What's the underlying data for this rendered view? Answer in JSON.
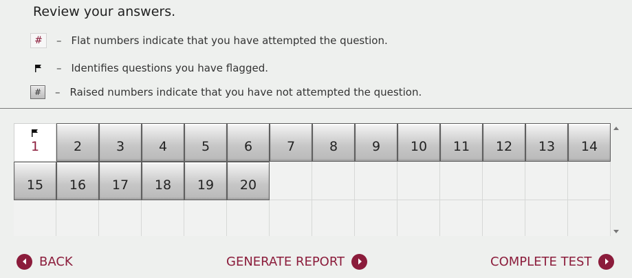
{
  "header": {
    "title": "Review your answers."
  },
  "legend": [
    {
      "symbol": "#",
      "dash": "–",
      "text": "Flat numbers indicate that you have attempted the question."
    },
    {
      "symbol": "",
      "dash": "–",
      "text": "Identifies questions you have flagged."
    },
    {
      "symbol": "#",
      "dash": "–",
      "text": "Raised numbers indicate that you have not attempted the question."
    }
  ],
  "questions": [
    {
      "label": "1",
      "attempted": true,
      "flagged": true
    },
    {
      "label": "2",
      "attempted": false,
      "flagged": false
    },
    {
      "label": "3",
      "attempted": false,
      "flagged": false
    },
    {
      "label": "4",
      "attempted": false,
      "flagged": false
    },
    {
      "label": "5",
      "attempted": false,
      "flagged": false
    },
    {
      "label": "6",
      "attempted": false,
      "flagged": false
    },
    {
      "label": "7",
      "attempted": false,
      "flagged": false
    },
    {
      "label": "8",
      "attempted": false,
      "flagged": false
    },
    {
      "label": "9",
      "attempted": false,
      "flagged": false
    },
    {
      "label": "10",
      "attempted": false,
      "flagged": false
    },
    {
      "label": "11",
      "attempted": false,
      "flagged": false
    },
    {
      "label": "12",
      "attempted": false,
      "flagged": false
    },
    {
      "label": "13",
      "attempted": false,
      "flagged": false
    },
    {
      "label": "14",
      "attempted": false,
      "flagged": false
    },
    {
      "label": "15",
      "attempted": false,
      "flagged": false
    },
    {
      "label": "16",
      "attempted": false,
      "flagged": false
    },
    {
      "label": "17",
      "attempted": false,
      "flagged": false
    },
    {
      "label": "18",
      "attempted": false,
      "flagged": false
    },
    {
      "label": "19",
      "attempted": false,
      "flagged": false
    },
    {
      "label": "20",
      "attempted": false,
      "flagged": false
    }
  ],
  "footer": {
    "back_label": "BACK",
    "report_label": "GENERATE REPORT",
    "complete_label": "COMPLETE TEST"
  },
  "colors": {
    "accent": "#8b1c3b",
    "background": "#eef0ee"
  },
  "icons": {
    "legend_flag": "flag-icon",
    "back": "chevron-left-circle-icon",
    "report": "chevron-right-circle-icon",
    "complete": "chevron-right-circle-icon"
  }
}
